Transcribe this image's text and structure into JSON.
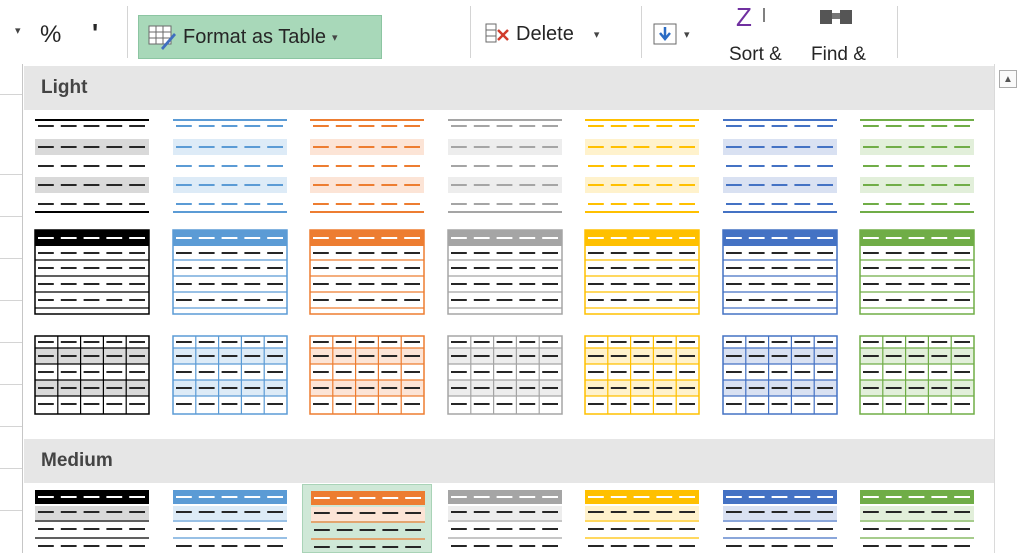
{
  "ribbon": {
    "percent_symbol": "%",
    "comma_symbol": "'",
    "format_as_table_label": "Format as Table",
    "delete_label": "Delete",
    "sort_label": "Sort &",
    "find_label": "Find &",
    "caret": "▾"
  },
  "gallery": {
    "sections": [
      {
        "label": "Light"
      },
      {
        "label": "Medium"
      }
    ],
    "theme_colors": [
      "#000000",
      "#5b9bd5",
      "#ed7d31",
      "#a5a5a5",
      "#ffc000",
      "#4472c4",
      "#70ad47"
    ],
    "theme_tints": [
      "#d9d9d9",
      "#ddebf7",
      "#fce4d6",
      "#ededed",
      "#fff2cc",
      "#d9e1f2",
      "#e2efda"
    ],
    "medium_highlight_index": 2
  },
  "scrollbar": {
    "up_arrow": "▲"
  }
}
